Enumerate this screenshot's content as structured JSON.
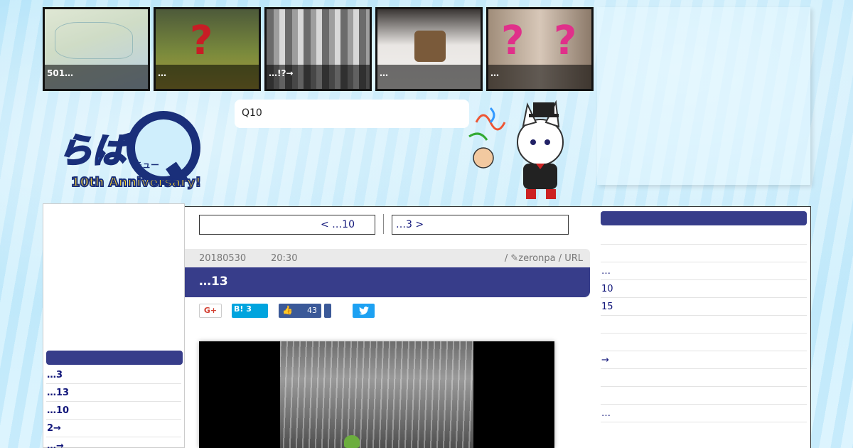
{
  "thumbnails": [
    {
      "caption": "501…"
    },
    {
      "caption": "…"
    },
    {
      "caption": "…!?→"
    },
    {
      "caption": "…"
    },
    {
      "caption": "…"
    }
  ],
  "logo": {
    "top": "らば",
    "small": "キュー",
    "bottom": "10th Anniversary!"
  },
  "search": {
    "value": "Q10"
  },
  "pager": {
    "prev": "< …10",
    "next": "…3 >"
  },
  "post": {
    "date": "20180530",
    "time": "20:30",
    "author": "/ ✎zeronpa / URL",
    "title": "…13"
  },
  "share": {
    "gplus": "G+",
    "hatena": "B! 3",
    "facebook_count": "43"
  },
  "left_sidebar": [
    "…3",
    "…13",
    "…10",
    "2→",
    "…→"
  ],
  "right_sidebar": [
    "",
    "",
    "…",
    "10",
    "15",
    "",
    "",
    "→",
    "",
    "",
    "…"
  ],
  "colors": {
    "accent": "#373d8a",
    "link": "#11167a",
    "background": "#cdeefc"
  }
}
